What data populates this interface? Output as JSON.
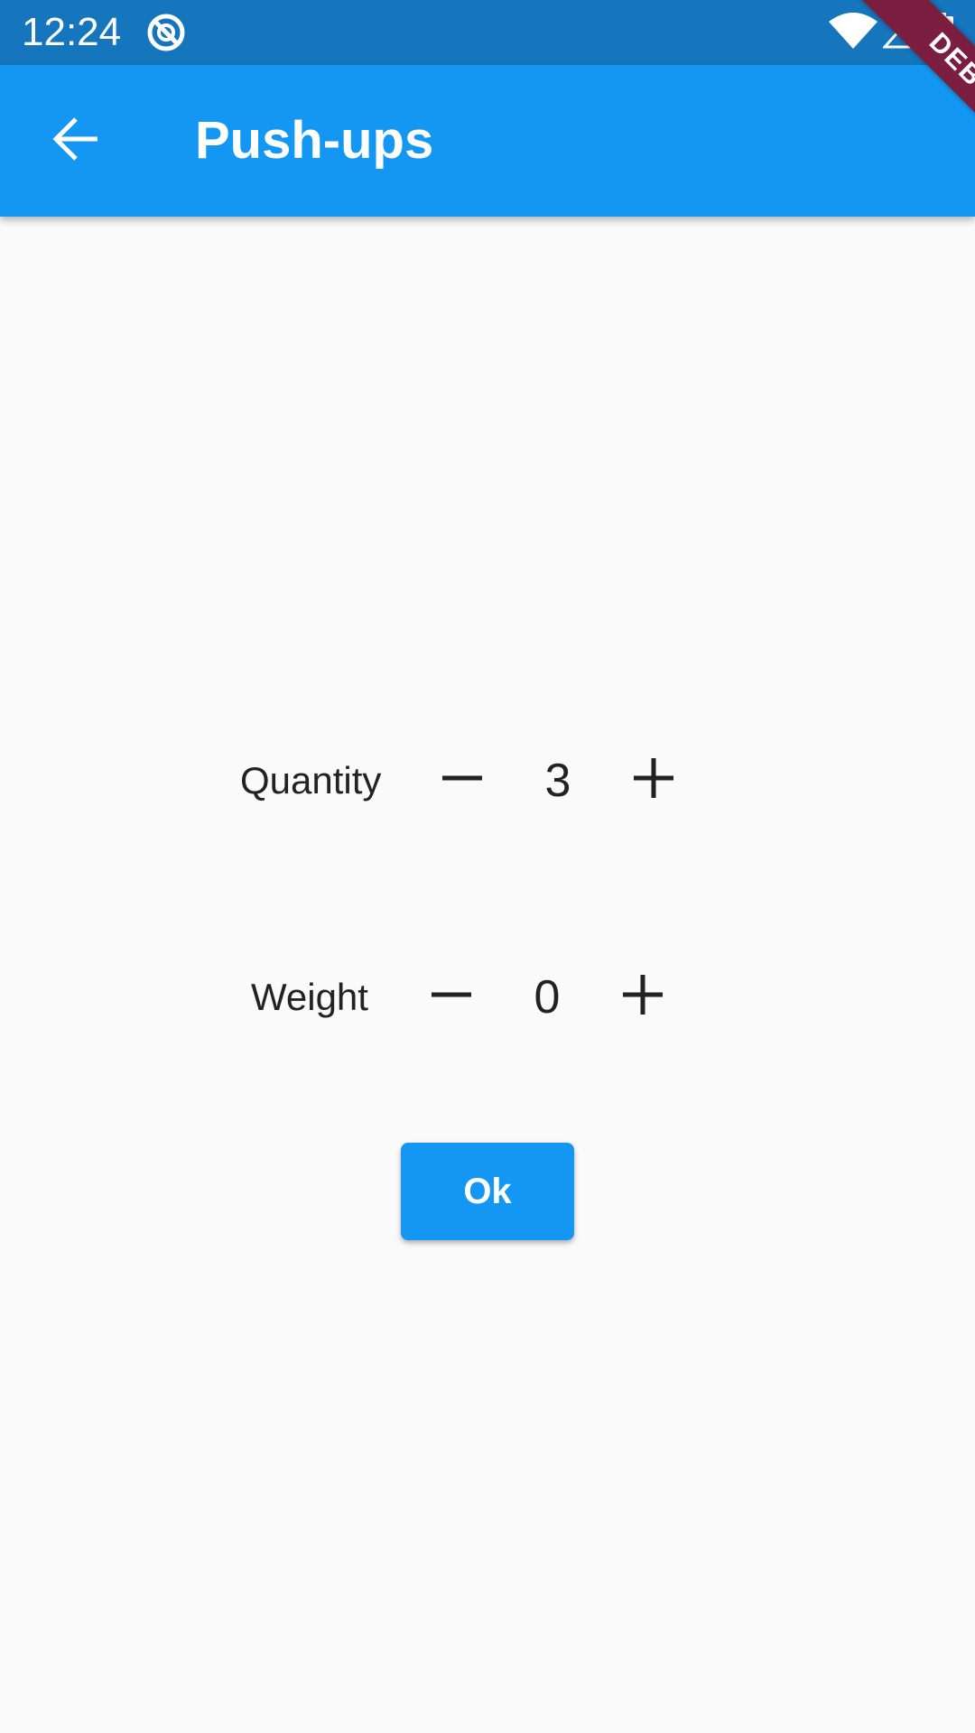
{
  "status_bar": {
    "time": "12:24",
    "icons": [
      "app-notification-icon",
      "wifi-icon",
      "signal-icon",
      "battery-icon"
    ]
  },
  "app_bar": {
    "title": "Push-ups",
    "back_icon": "arrow-back-icon",
    "background_color": "#1497f2"
  },
  "debug_banner": {
    "label": "DEBUG",
    "color": "#7b1e3f"
  },
  "steppers": {
    "quantity": {
      "label": "Quantity",
      "value": "3",
      "decrement_icon": "minus-icon",
      "increment_icon": "plus-icon"
    },
    "weight": {
      "label": "Weight",
      "value": "0",
      "decrement_icon": "minus-icon",
      "increment_icon": "plus-icon"
    }
  },
  "actions": {
    "ok_label": "Ok",
    "ok_color": "#1497f2"
  }
}
